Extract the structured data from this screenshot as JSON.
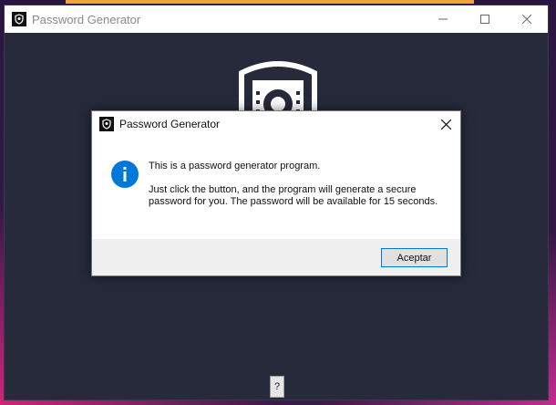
{
  "main_window": {
    "title": "Password Generator",
    "help_button_label": "?"
  },
  "dialog": {
    "title": "Password Generator",
    "message_line1": "This is a password generator program.",
    "message_line2": "Just click the button, and the program will generate a secure password for you. The password will be available for 15 seconds.",
    "ok_label": "Aceptar"
  },
  "colors": {
    "window_background": "#262a3a",
    "info_blue": "#0078d7"
  },
  "icons": [
    "app-icon",
    "minimize-icon",
    "maximize-icon",
    "close-icon",
    "shield-logo-icon",
    "info-icon"
  ]
}
